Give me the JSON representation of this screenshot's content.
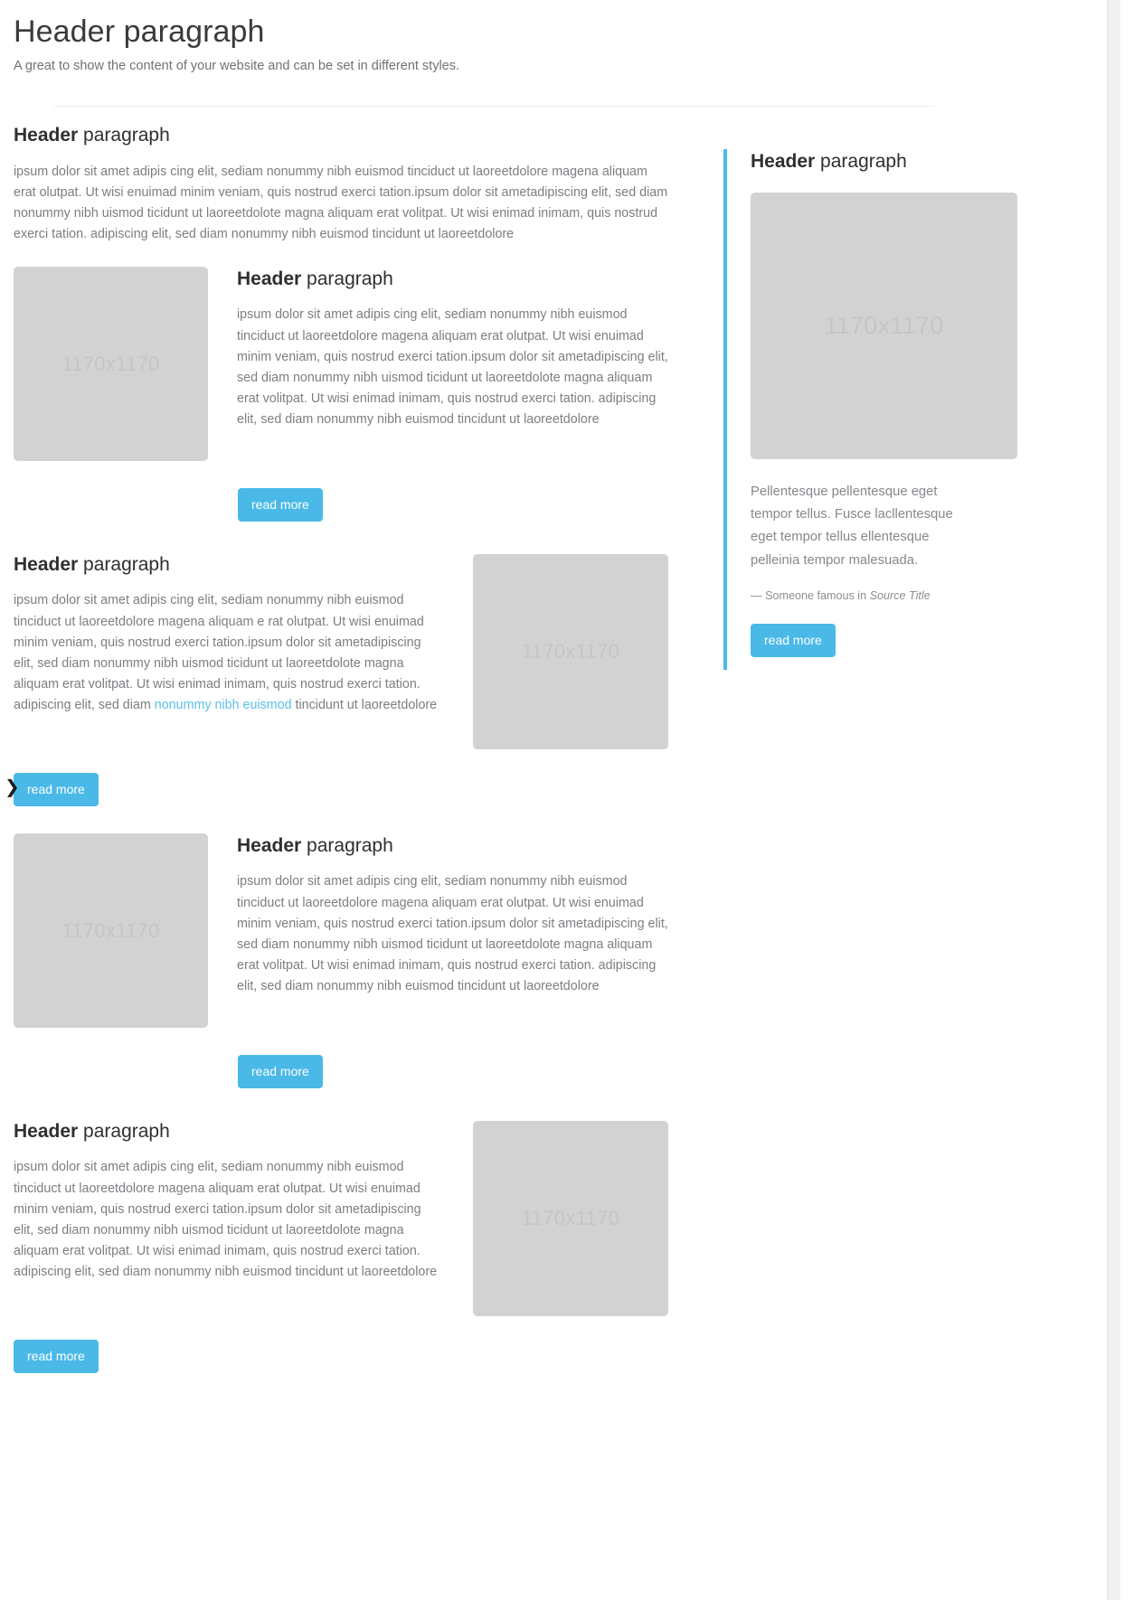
{
  "header": {
    "title": "Header paragraph",
    "subtitle": "A great to show the content of your website and can be set in different styles."
  },
  "theme": {
    "accent": "#4ab9e8",
    "link": "#5bc0e8",
    "placeholder_bg": "#d2d2d2",
    "text": "#7b7e82"
  },
  "labels": {
    "read_more": "read more",
    "placeholder": "1170x1170",
    "header_bold": "Header",
    "header_light": " paragraph"
  },
  "intro": {
    "heading_bold": "Header",
    "heading_light": " paragraph",
    "body": "ipsum dolor sit amet adipis cing elit, sediam nonummy nibh euismod tinciduct ut laoreetdolore magena aliquam erat olutpat. Ut wisi enuimad minim veniam, quis nostrud exerci tation.ipsum dolor sit ametadipiscing elit, sed diam nonummy nibh uismod ticidunt ut laoreetdolote magna aliquam erat volitpat. Ut wisi enimad inimam, quis nostrud exerci tation. adipiscing elit, sed diam nonummy nibh euismod tincidunt ut laoreetdolore"
  },
  "sections": [
    {
      "id": "media-1",
      "layout": "image-left",
      "image_label": "1170x1170",
      "heading_bold": "Header",
      "heading_light": " paragraph",
      "body": "ipsum dolor sit amet adipis cing elit, sediam nonummy nibh euismod tinciduct ut laoreetdolore magena aliquam erat olutpat. Ut wisi enuimad minim veniam, quis nostrud exerci tation.ipsum dolor sit ametadipiscing elit, sed diam nonummy nibh uismod ticidunt ut laoreetdolote magna aliquam erat volitpat. Ut wisi enimad inimam, quis nostrud exerci tation. adipiscing elit, sed diam nonummy nibh euismod tincidunt ut laoreetdolore",
      "button": "read more"
    },
    {
      "id": "media-2",
      "layout": "image-right",
      "image_label": "1170x1170",
      "heading_bold": "Header",
      "heading_light": " paragraph",
      "body_part1": "ipsum dolor sit amet adipis cing elit, sediam nonummy nibh euismod tinciduct ut laoreetdolore magena aliquam e rat olutpat. Ut wisi enuimad minim veniam, quis nostrud exerci tation.ipsum dolor sit ametadipiscing elit, sed diam nonummy nibh uismod ticidunt ut laoreetdolote magna aliquam erat volitpat. Ut wisi enimad inimam, quis nostrud exerci tation. adipiscing elit, sed diam ",
      "body_link": "nonummy nibh euismod",
      "body_part2": " tincidunt ut laoreetdolore",
      "button": "read more"
    },
    {
      "id": "media-3",
      "layout": "image-left",
      "image_label": "1170x1170",
      "heading_bold": "Header",
      "heading_light": " paragraph",
      "body": "ipsum dolor sit amet adipis cing elit, sediam nonummy nibh euismod tinciduct ut laoreetdolore magena aliquam erat olutpat. Ut wisi enuimad minim veniam, quis nostrud exerci tation.ipsum dolor sit ametadipiscing elit, sed diam nonummy nibh uismod ticidunt ut laoreetdolote magna aliquam erat volitpat. Ut wisi enimad inimam, quis nostrud exerci tation. adipiscing elit, sed diam nonummy nibh euismod tincidunt ut laoreetdolore",
      "button": "read more"
    },
    {
      "id": "media-4",
      "layout": "image-right",
      "image_label": "1170x1170",
      "heading_bold": "Header",
      "heading_light": " paragraph",
      "body": "ipsum dolor sit amet adipis cing elit, sediam nonummy nibh euismod tinciduct ut laoreetdolore magena aliquam erat olutpat. Ut wisi enuimad minim veniam, quis nostrud exerci tation.ipsum dolor sit ametadipiscing elit, sed diam nonummy nibh uismod ticidunt ut laoreetdolote magna aliquam erat volitpat. Ut wisi enimad inimam, quis nostrud exerci tation. adipiscing elit, sed diam nonummy nibh euismod tincidunt ut laoreetdolore",
      "button": "read more"
    }
  ],
  "sidebar": {
    "heading_bold": "Header",
    "heading_light": " paragraph",
    "image_label": "1170x1170",
    "quote": "Pellentesque pellentesque eget tempor tellus. Fusce lacllentesque eget tempor tellus ellentesque pelleinia tempor malesuada.",
    "attribution_prefix": "— Someone famous in ",
    "attribution_source": "Source Title",
    "button": "read more"
  },
  "cursor": {
    "glyph": "❯"
  }
}
